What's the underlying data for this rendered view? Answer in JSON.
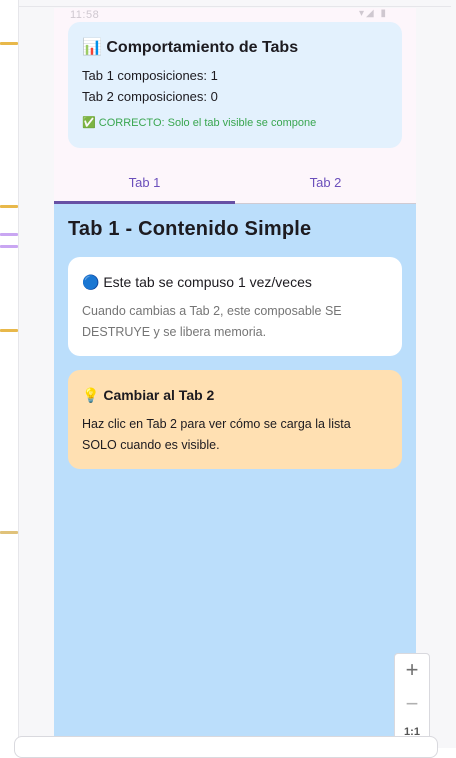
{
  "status_bar": {
    "time": "11:58",
    "right_icons": "▾◢ ▮"
  },
  "info_card": {
    "icon": "bar-chart-icon",
    "title_emoji": "📊",
    "title": "Comportamiento de Tabs",
    "tab1_count_line": "Tab 1 composiciones: 1",
    "tab2_count_line": "Tab 2 composiciones: 0",
    "ok_emoji": "✅",
    "ok_message": "CORRECTO: Solo el tab visible se compone",
    "ok_color": "#3aa650"
  },
  "tabs": [
    {
      "label": "Tab 1",
      "selected": true
    },
    {
      "label": "Tab 2",
      "selected": false
    }
  ],
  "content": {
    "title": "Tab 1 - Contenido Simple",
    "white_card": {
      "emoji": "🔵",
      "title": "Este tab se compuso 1 vez/veces",
      "body": "Cuando cambias a Tab 2, este composable SE DESTRUYE y se libera memoria."
    },
    "orange_card": {
      "emoji": "💡",
      "title": "Cambiar al Tab 2",
      "body": "Haz clic en Tab 2 para ver cómo se carga la lista SOLO cuando es visible."
    }
  },
  "zoom": {
    "zoom_in": "+",
    "zoom_out": "−",
    "ratio": "1:1"
  },
  "colors": {
    "accent": "#6750a4",
    "content_bg": "#bbdefb",
    "info_bg": "#e3f1fd",
    "orange_bg": "#ffe0b2"
  }
}
